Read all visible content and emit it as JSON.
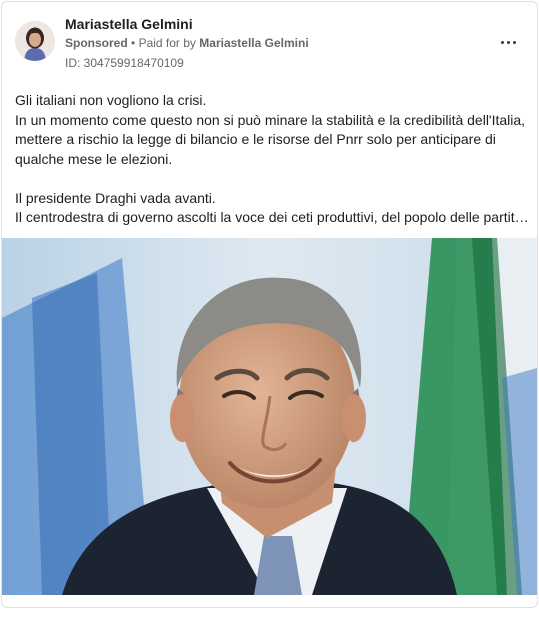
{
  "post": {
    "author": "Mariastella Gelmini",
    "sponsored_label": "Sponsored",
    "separator": "•",
    "paid_for_label": "Paid for by",
    "paid_for_name": "Mariastella Gelmini",
    "ad_id": "ID: 304759918470109",
    "more_icon": "more-horizontal-icon",
    "text_lines": [
      "Gli italiani non vogliono la crisi.",
      "In un momento come questo non si può minare la stabilità e la credibilità dell'Italia,",
      "mettere a rischio la legge di bilancio e le risorse del Pnrr solo per anticipare di",
      "qualche mese le elezioni.",
      "",
      "Il presidente Draghi vada avanti.",
      "Il centrodestra di governo ascolti la voce dei ceti produttivi, del popolo delle partit…"
    ]
  },
  "colors": {
    "text_primary": "#1c1e21",
    "text_secondary": "#65676b",
    "card_border": "#dfe1e5",
    "photo_background": "#cfe0ee",
    "flag_green": "#1f8a4c",
    "flag_blue": "#3b78c4"
  }
}
